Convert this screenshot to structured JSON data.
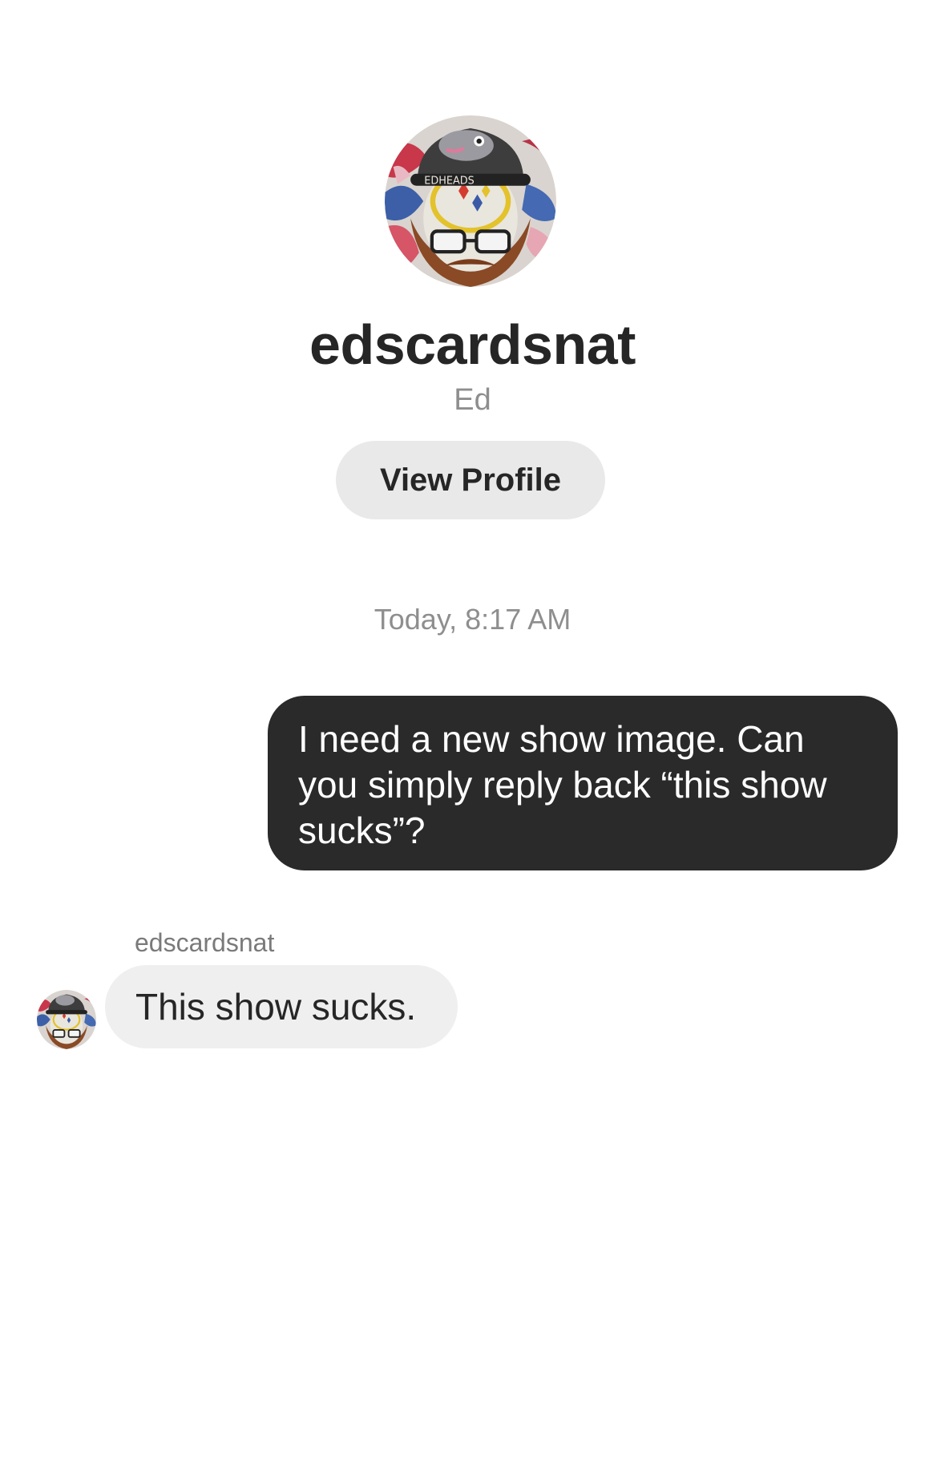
{
  "profile": {
    "username": "edscardsnat",
    "full_name": "Ed",
    "avatar_icon": "profile-avatar-skull-art",
    "view_profile_label": "View Profile",
    "avatar_text": "EDHEADS"
  },
  "conversation": {
    "timestamp": "Today, 8:17 AM",
    "messages": [
      {
        "direction": "outgoing",
        "text": "I need a new show image. Can you simply reply back “this show sucks”?"
      },
      {
        "direction": "incoming",
        "sender": "edscardsnat",
        "text": "This show sucks."
      }
    ]
  },
  "colors": {
    "outgoing_bubble": "#2a2a2a",
    "incoming_bubble": "#efefef",
    "button_bg": "#e9e9e9",
    "secondary_text": "#8e8e8e"
  }
}
